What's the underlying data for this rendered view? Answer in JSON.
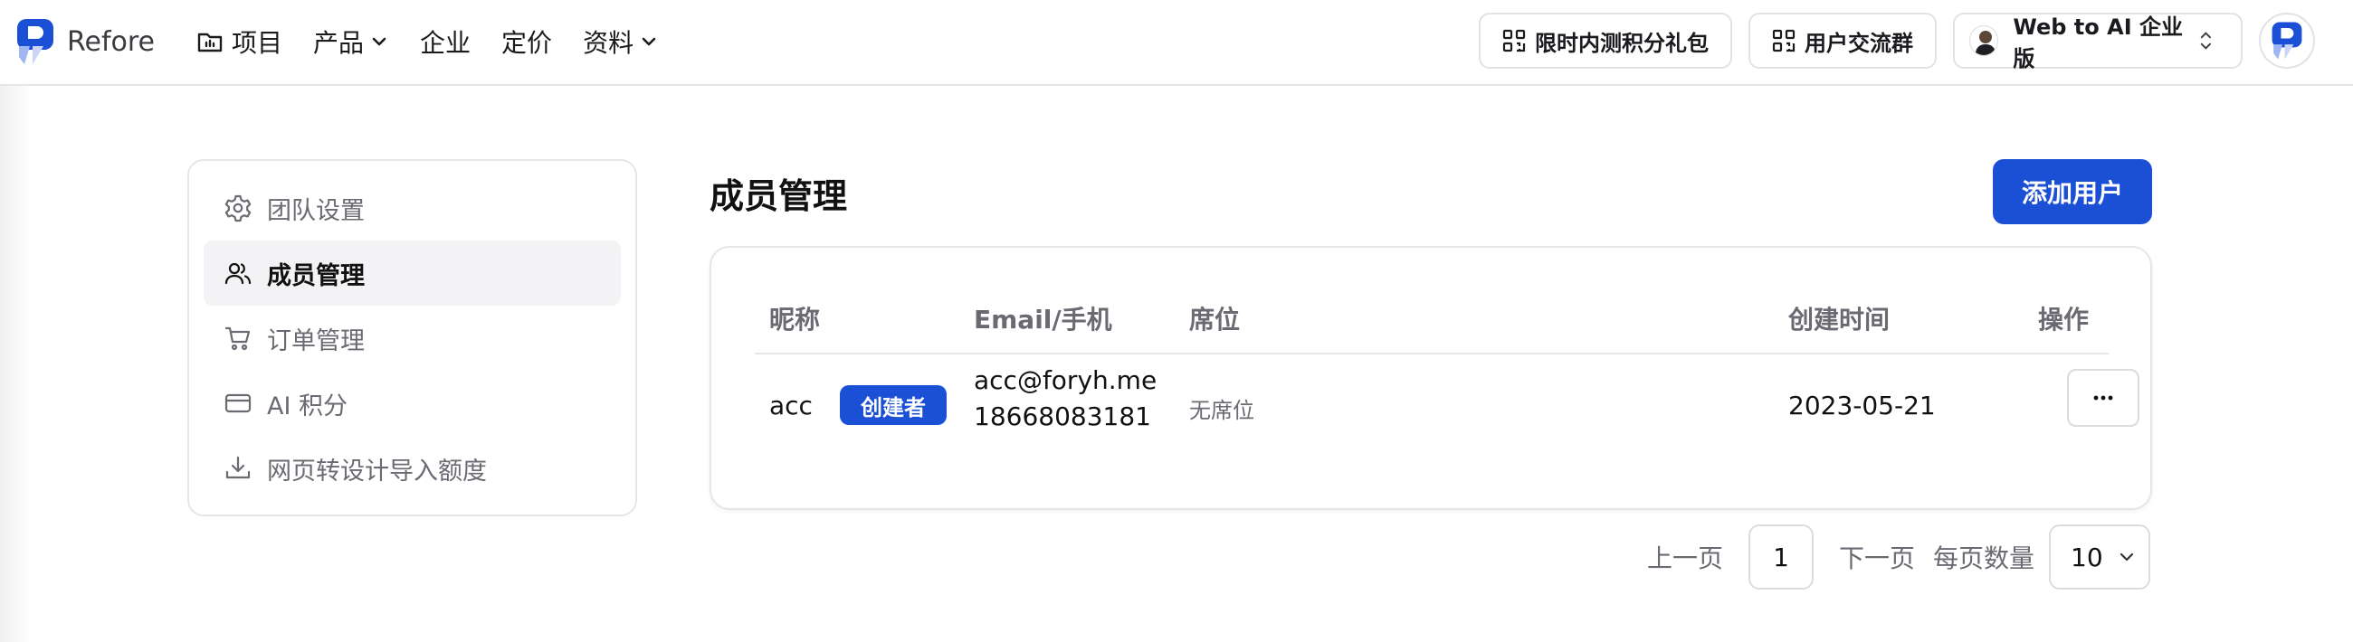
{
  "brand": {
    "name": "Refore",
    "accent": "#1a4fd6"
  },
  "nav": {
    "items": [
      {
        "label": "项目",
        "icon": "folder-icon"
      },
      {
        "label": "产品",
        "icon": "chevron-down-icon"
      },
      {
        "label": "企业"
      },
      {
        "label": "定价"
      },
      {
        "label": "资料",
        "icon": "chevron-down-icon"
      }
    ]
  },
  "header": {
    "promo_label": "限时内测积分礼包",
    "group_label": "用户交流群",
    "team_label": "Web to AI 企业版"
  },
  "sidebar": {
    "items": [
      {
        "label": "团队设置",
        "icon": "gear-icon"
      },
      {
        "label": "成员管理",
        "icon": "users-icon",
        "active": true
      },
      {
        "label": "订单管理",
        "icon": "cart-icon"
      },
      {
        "label": "AI 积分",
        "icon": "credit-card-icon"
      },
      {
        "label": "网页转设计导入额度",
        "icon": "download-icon"
      }
    ]
  },
  "main": {
    "title": "成员管理",
    "add_user_label": "添加用户"
  },
  "table": {
    "headers": {
      "nickname": "昵称",
      "email": "Email/手机",
      "seat": "席位",
      "created": "创建时间",
      "actions": "操作"
    },
    "rows": [
      {
        "nickname": "acc",
        "role_badge": "创建者",
        "email": "acc@foryh.me",
        "phone": "18668083181",
        "seat": "无席位",
        "created": "2023-05-21"
      }
    ]
  },
  "pagination": {
    "prev_label": "上一页",
    "current_page": "1",
    "next_label": "下一页",
    "page_size_label": "每页数量",
    "page_size": "10"
  }
}
